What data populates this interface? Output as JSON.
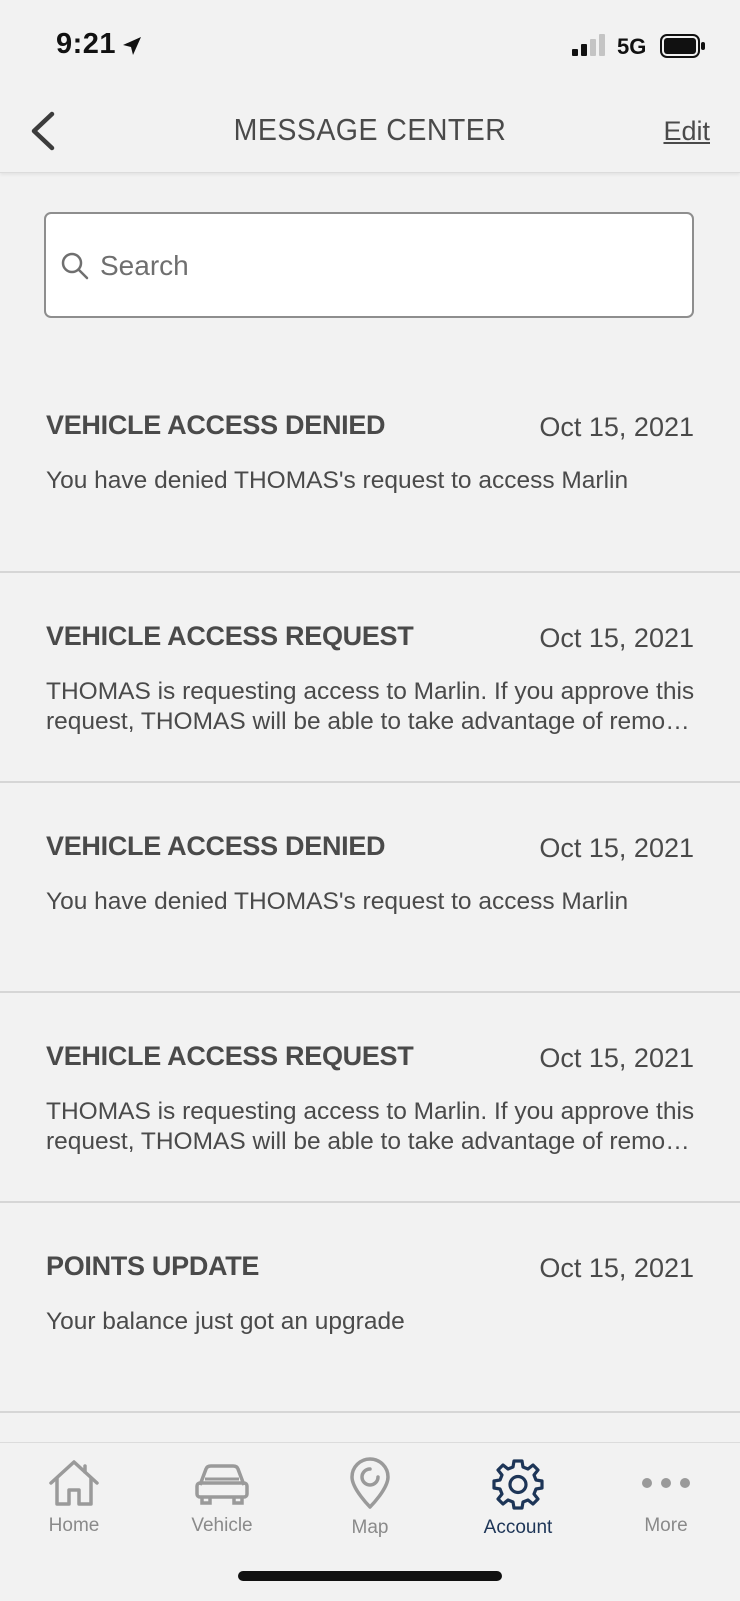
{
  "status_bar": {
    "time": "9:21",
    "network": "5G",
    "icons": [
      "location-arrow-icon",
      "signal-bars-icon",
      "battery-icon"
    ]
  },
  "header": {
    "title": "MESSAGE CENTER",
    "edit_label": "Edit",
    "back_icon": "chevron-left-icon"
  },
  "search": {
    "placeholder": "Search",
    "value": ""
  },
  "messages": [
    {
      "title": "VEHICLE ACCESS DENIED",
      "date": "Oct 15, 2021",
      "body": "You have denied THOMAS's request to access Marlin"
    },
    {
      "title": "VEHICLE ACCESS REQUEST",
      "date": "Oct 15, 2021",
      "body": "THOMAS is requesting access to Marlin. If you approve this request, THOMAS will be able to take advantage of remote features"
    },
    {
      "title": "VEHICLE ACCESS DENIED",
      "date": "Oct 15, 2021",
      "body": "You have denied THOMAS's request to access Marlin"
    },
    {
      "title": "VEHICLE ACCESS REQUEST",
      "date": "Oct 15, 2021",
      "body": "THOMAS is requesting access to Marlin. If you approve this request, THOMAS will be able to take advantage of remote features"
    },
    {
      "title": "POINTS UPDATE",
      "date": "Oct 15, 2021",
      "body": "Your balance just got an upgrade"
    }
  ],
  "tab_bar": {
    "tabs": [
      {
        "label": "Home",
        "icon": "home-icon"
      },
      {
        "label": "Vehicle",
        "icon": "car-icon"
      },
      {
        "label": "Map",
        "icon": "map-pin-icon"
      },
      {
        "label": "Account",
        "icon": "gear-icon",
        "active": true
      },
      {
        "label": "More",
        "icon": "more-dots-icon"
      }
    ]
  },
  "colors": {
    "background": "#f2f2f2",
    "text": "#4a4a4a",
    "active_tab": "#1d3557",
    "inactive_tab": "#8a8a8a"
  }
}
